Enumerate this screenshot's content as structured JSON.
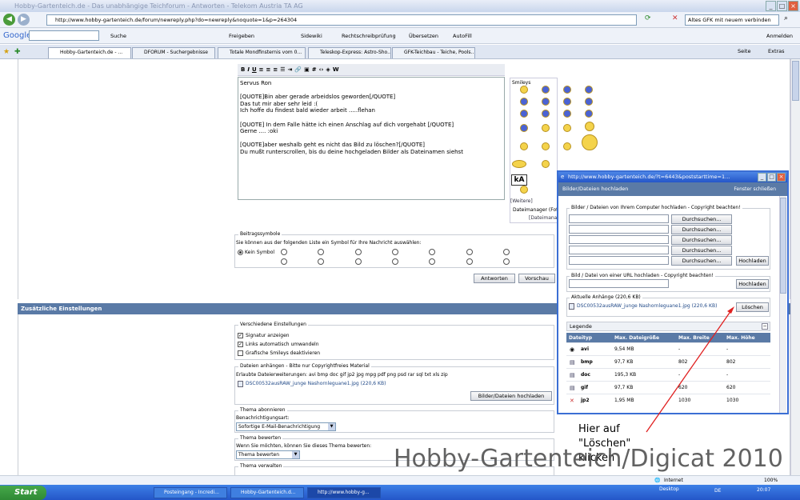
{
  "window": {
    "title": "Hobby-Gartenteich.de - Das unabhängige Teichforum - Antworten - Telekom Austria TA AG"
  },
  "address": {
    "url": "http://www.hobby-gartenteich.de/forum/newreply.php?do=newreply&noquote=1&p=264304",
    "search": "Altes GFK mit neuem verbinden"
  },
  "google_bar": {
    "logo": "Google",
    "search_label": "Suche",
    "freigeben": "Freigeben",
    "sidewiki": "Sidewiki",
    "rechtschreib": "Rechtschreibprüfung",
    "uebersetzen": "Übersetzen",
    "autofill": "AutoFill",
    "anmelden": "Anmelden"
  },
  "tabs": [
    {
      "label": "Hobby-Gartenteich.de - ..."
    },
    {
      "label": "DFORUM - Suchergebnisse"
    },
    {
      "label": "Totale Mondfinsternis vom 0..."
    },
    {
      "label": "Teleskop-Express: Astro-Sho..."
    },
    {
      "label": "GFK-Teichbau - Teiche, Pools..."
    }
  ],
  "toolbar_right": {
    "seite": "Seite",
    "extras": "Extras"
  },
  "editor": {
    "lines": [
      "Servus Ron",
      "",
      "[QUOTE]Bin aber gerade arbeidslos geworden[/QUOTE]",
      "Das tut mir aber sehr leid :(",
      "Ich hoffe du findest bald wieder arbeit .....flehan",
      "",
      "[QUOTE] In dem Falle hätte ich einen Anschlag auf dich vorgehabt [/QUOTE]",
      "Gerne .... :oki",
      "",
      "[QUOTE]aber weshalb geht es nicht das Bild zu löschen?[/QUOTE]",
      "Du mußt runterscrollen, bis du deine hochgeladen Bilder als Dateinamen siehst"
    ]
  },
  "smilies": {
    "title": "Smileys",
    "more": "[Weitere]",
    "dateimanager": "Dateimanager (Fot",
    "dateimanager2": "[Dateimana",
    "ka": "kA"
  },
  "beitragssymbole": {
    "title": "Beitragssymbole",
    "desc": "Sie können aus der folgenden Liste ein Symbol für Ihre Nachricht auswählen:",
    "kein": "Kein Symbol"
  },
  "buttons": {
    "antworten": "Antworten",
    "vorschau": "Vorschau"
  },
  "zusatz": {
    "header": "Zusätzliche Einstellungen",
    "verschiedene": "Verschiedene Einstellungen",
    "signatur": "Signatur anzeigen",
    "links": "Links automatisch umwandeln",
    "smileys": "Grafische Smileys deaktivieren",
    "dateien_title": "Dateien anhängen - Bitte nur Copyrightfreies Material",
    "erlaubt": "Erlaubte Dateierweiterungen: avi bmp doc gif jp2 jpg mpg pdf png psd rar sql txt xls zip",
    "attachment": "DSC00532ausRAW_junge Nashornleguane1.jpg (220,6 KB)",
    "upload_btn": "Bilder/Dateien hochladen",
    "abonnieren": "Thema abonnieren",
    "benachrichtigung": "Benachrichtigungsart:",
    "benach_value": "Sofortige E-Mail-Benachrichtigung",
    "bewerten": "Thema bewerten",
    "bewerten_desc": "Wenn Sie möchten, können Sie dieses Thema bewerten:",
    "bewerten_value": "Thema bewerten",
    "verwalten": "Thema verwalten"
  },
  "popup": {
    "title": "http://www.hobby-gartenteich.de/?t=6443&poststarttime=1...",
    "header": "Bilder/Dateien hochladen",
    "close_link": "Fenster schließen",
    "local_legend": "Bilder / Dateien von Ihrem Computer hochladen - Copyright beachten!",
    "browse": "Durchsuchen...",
    "hochladen": "Hochladen",
    "url_legend": "Bild / Datei von einer URL hochladen - Copyright beachten!",
    "anhaenge_legend": "Aktuelle Anhänge (220,6 KB)",
    "attachment": "DSC00532ausRAW_junge Nashornleguane1.jpg (220,6 KB)",
    "loeschen": "Löschen",
    "legende": "Legende",
    "cols": [
      "Dateityp",
      "Max. Dateigröße",
      "Max. Breite",
      "Max. Höhe"
    ],
    "rows": [
      [
        "avi",
        "9,54 MB",
        "-",
        "-"
      ],
      [
        "bmp",
        "97,7 KB",
        "802",
        "802"
      ],
      [
        "doc",
        "195,3 KB",
        "-",
        "-"
      ],
      [
        "gif",
        "97,7 KB",
        "620",
        "620"
      ],
      [
        "jp2",
        "1,95 MB",
        "1030",
        "1030"
      ]
    ]
  },
  "annotation": {
    "line1": "Hier auf",
    "line2": "\"Löschen\"",
    "line3": "klicken"
  },
  "watermark": "Hobby-Gartenteich/Digicat 2010",
  "statusbar": {
    "internet": "Internet",
    "zoom": "100%"
  },
  "taskbar": {
    "start": "Start",
    "items": [
      "Posteingang - Incredi...",
      "Hobby-Gartenteich.d...",
      "http://www.hobby-g..."
    ],
    "desktop": "Desktop",
    "lang": "DE",
    "clock": "20:07"
  }
}
